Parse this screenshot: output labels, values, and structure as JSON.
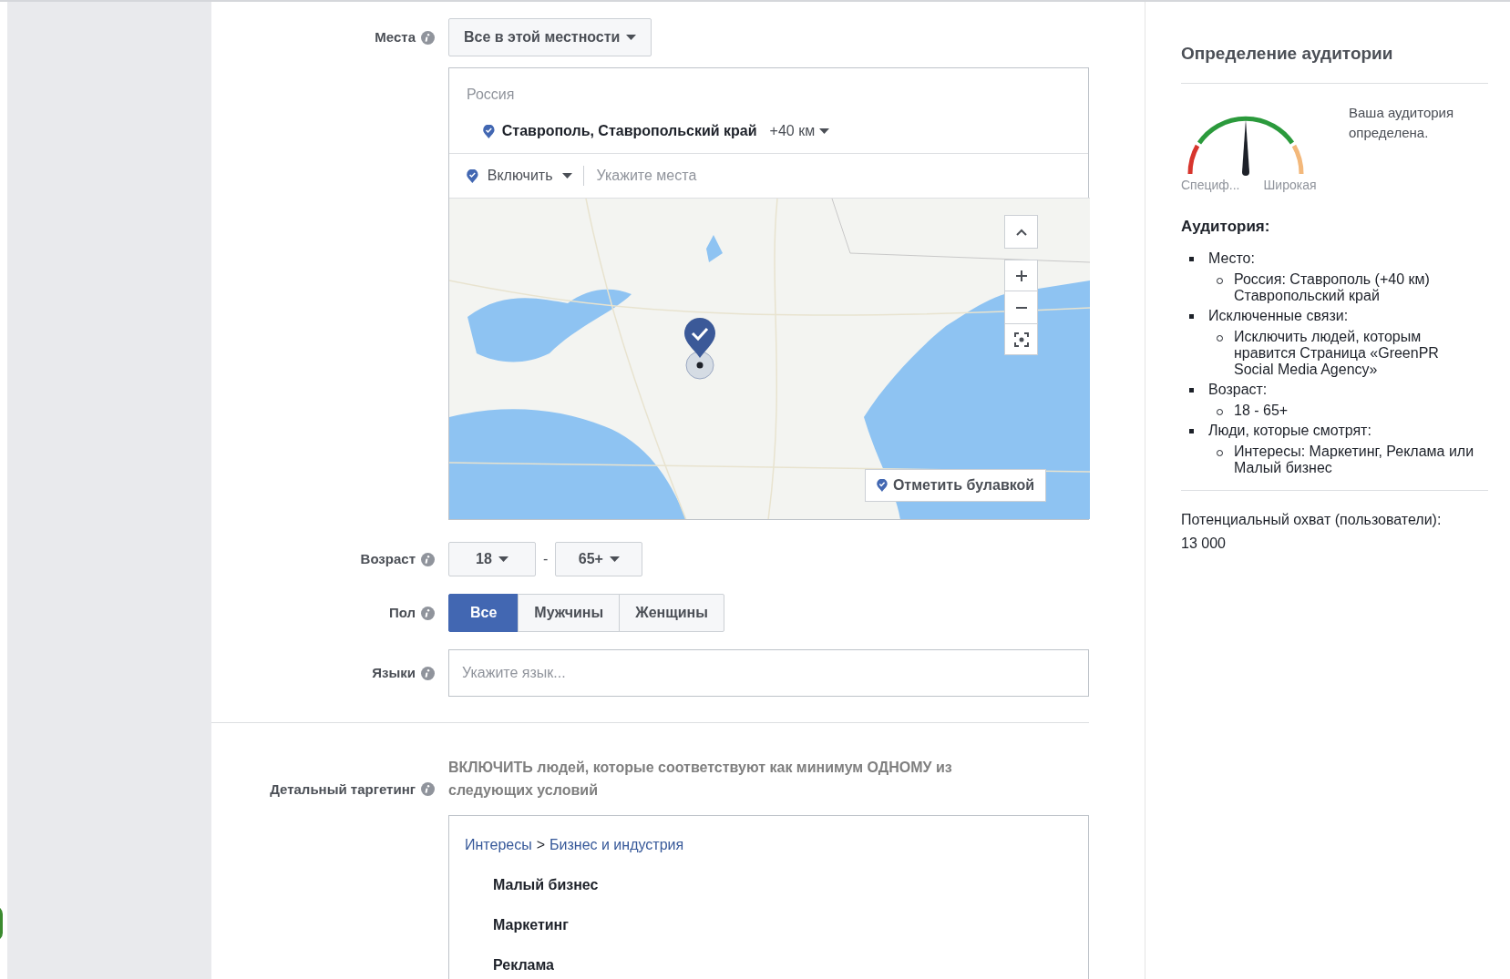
{
  "locations": {
    "label": "Места",
    "type_dropdown": "Все в этой местности",
    "country": "Россия",
    "place": {
      "name": "Ставрополь, Ставропольский край",
      "radius": "+40 км"
    },
    "include_dropdown": "Включить",
    "search_placeholder": "Укажите места",
    "map": {
      "drop_pin_button": "Отметить булавкой"
    }
  },
  "age": {
    "label": "Возраст",
    "from": "18",
    "separator": "-",
    "to": "65+"
  },
  "gender": {
    "label": "Пол",
    "options": [
      {
        "label": "Все",
        "selected": true
      },
      {
        "label": "Мужчины",
        "selected": false
      },
      {
        "label": "Женщины",
        "selected": false
      }
    ]
  },
  "languages": {
    "label": "Языки",
    "placeholder": "Укажите язык..."
  },
  "detailed_targeting": {
    "label": "Детальный таргетинг",
    "instruction": "ВКЛЮЧИТЬ людей, которые соответствуют как минимум ОДНОМУ из следующих условий",
    "breadcrumb": {
      "category": "Интересы",
      "separator": ">",
      "subcategory": "Бизнес и индустрия"
    },
    "items": [
      "Малый бизнес",
      "Маркетинг",
      "Реклама"
    ]
  },
  "audience_panel": {
    "title": "Определение аудитории",
    "gauge": {
      "level": 0.5,
      "message": "Ваша аудитория определена.",
      "min_label": "Специф...",
      "max_label": "Широкая"
    },
    "heading": "Аудитория:",
    "criteria": [
      {
        "text": "Место:",
        "children": [
          {
            "text": "Россия: Ставрополь (+40 км) Ставропольский край"
          }
        ]
      },
      {
        "text": "Исключенные связи:",
        "children": [
          {
            "text": "Исключить людей, которым нравится Страница «GreenPR Social Media Agency»"
          }
        ]
      },
      {
        "text": "Возраст:",
        "children": [
          {
            "text": "18 - 65+"
          }
        ]
      },
      {
        "text": "Люди, которые смотрят:",
        "children": [
          {
            "text": "Интересы: Маркетинг, Реклама или Малый бизнес"
          }
        ]
      }
    ],
    "reach_label": "Потенциальный охват (пользователи):",
    "reach_value": "13 000"
  }
}
